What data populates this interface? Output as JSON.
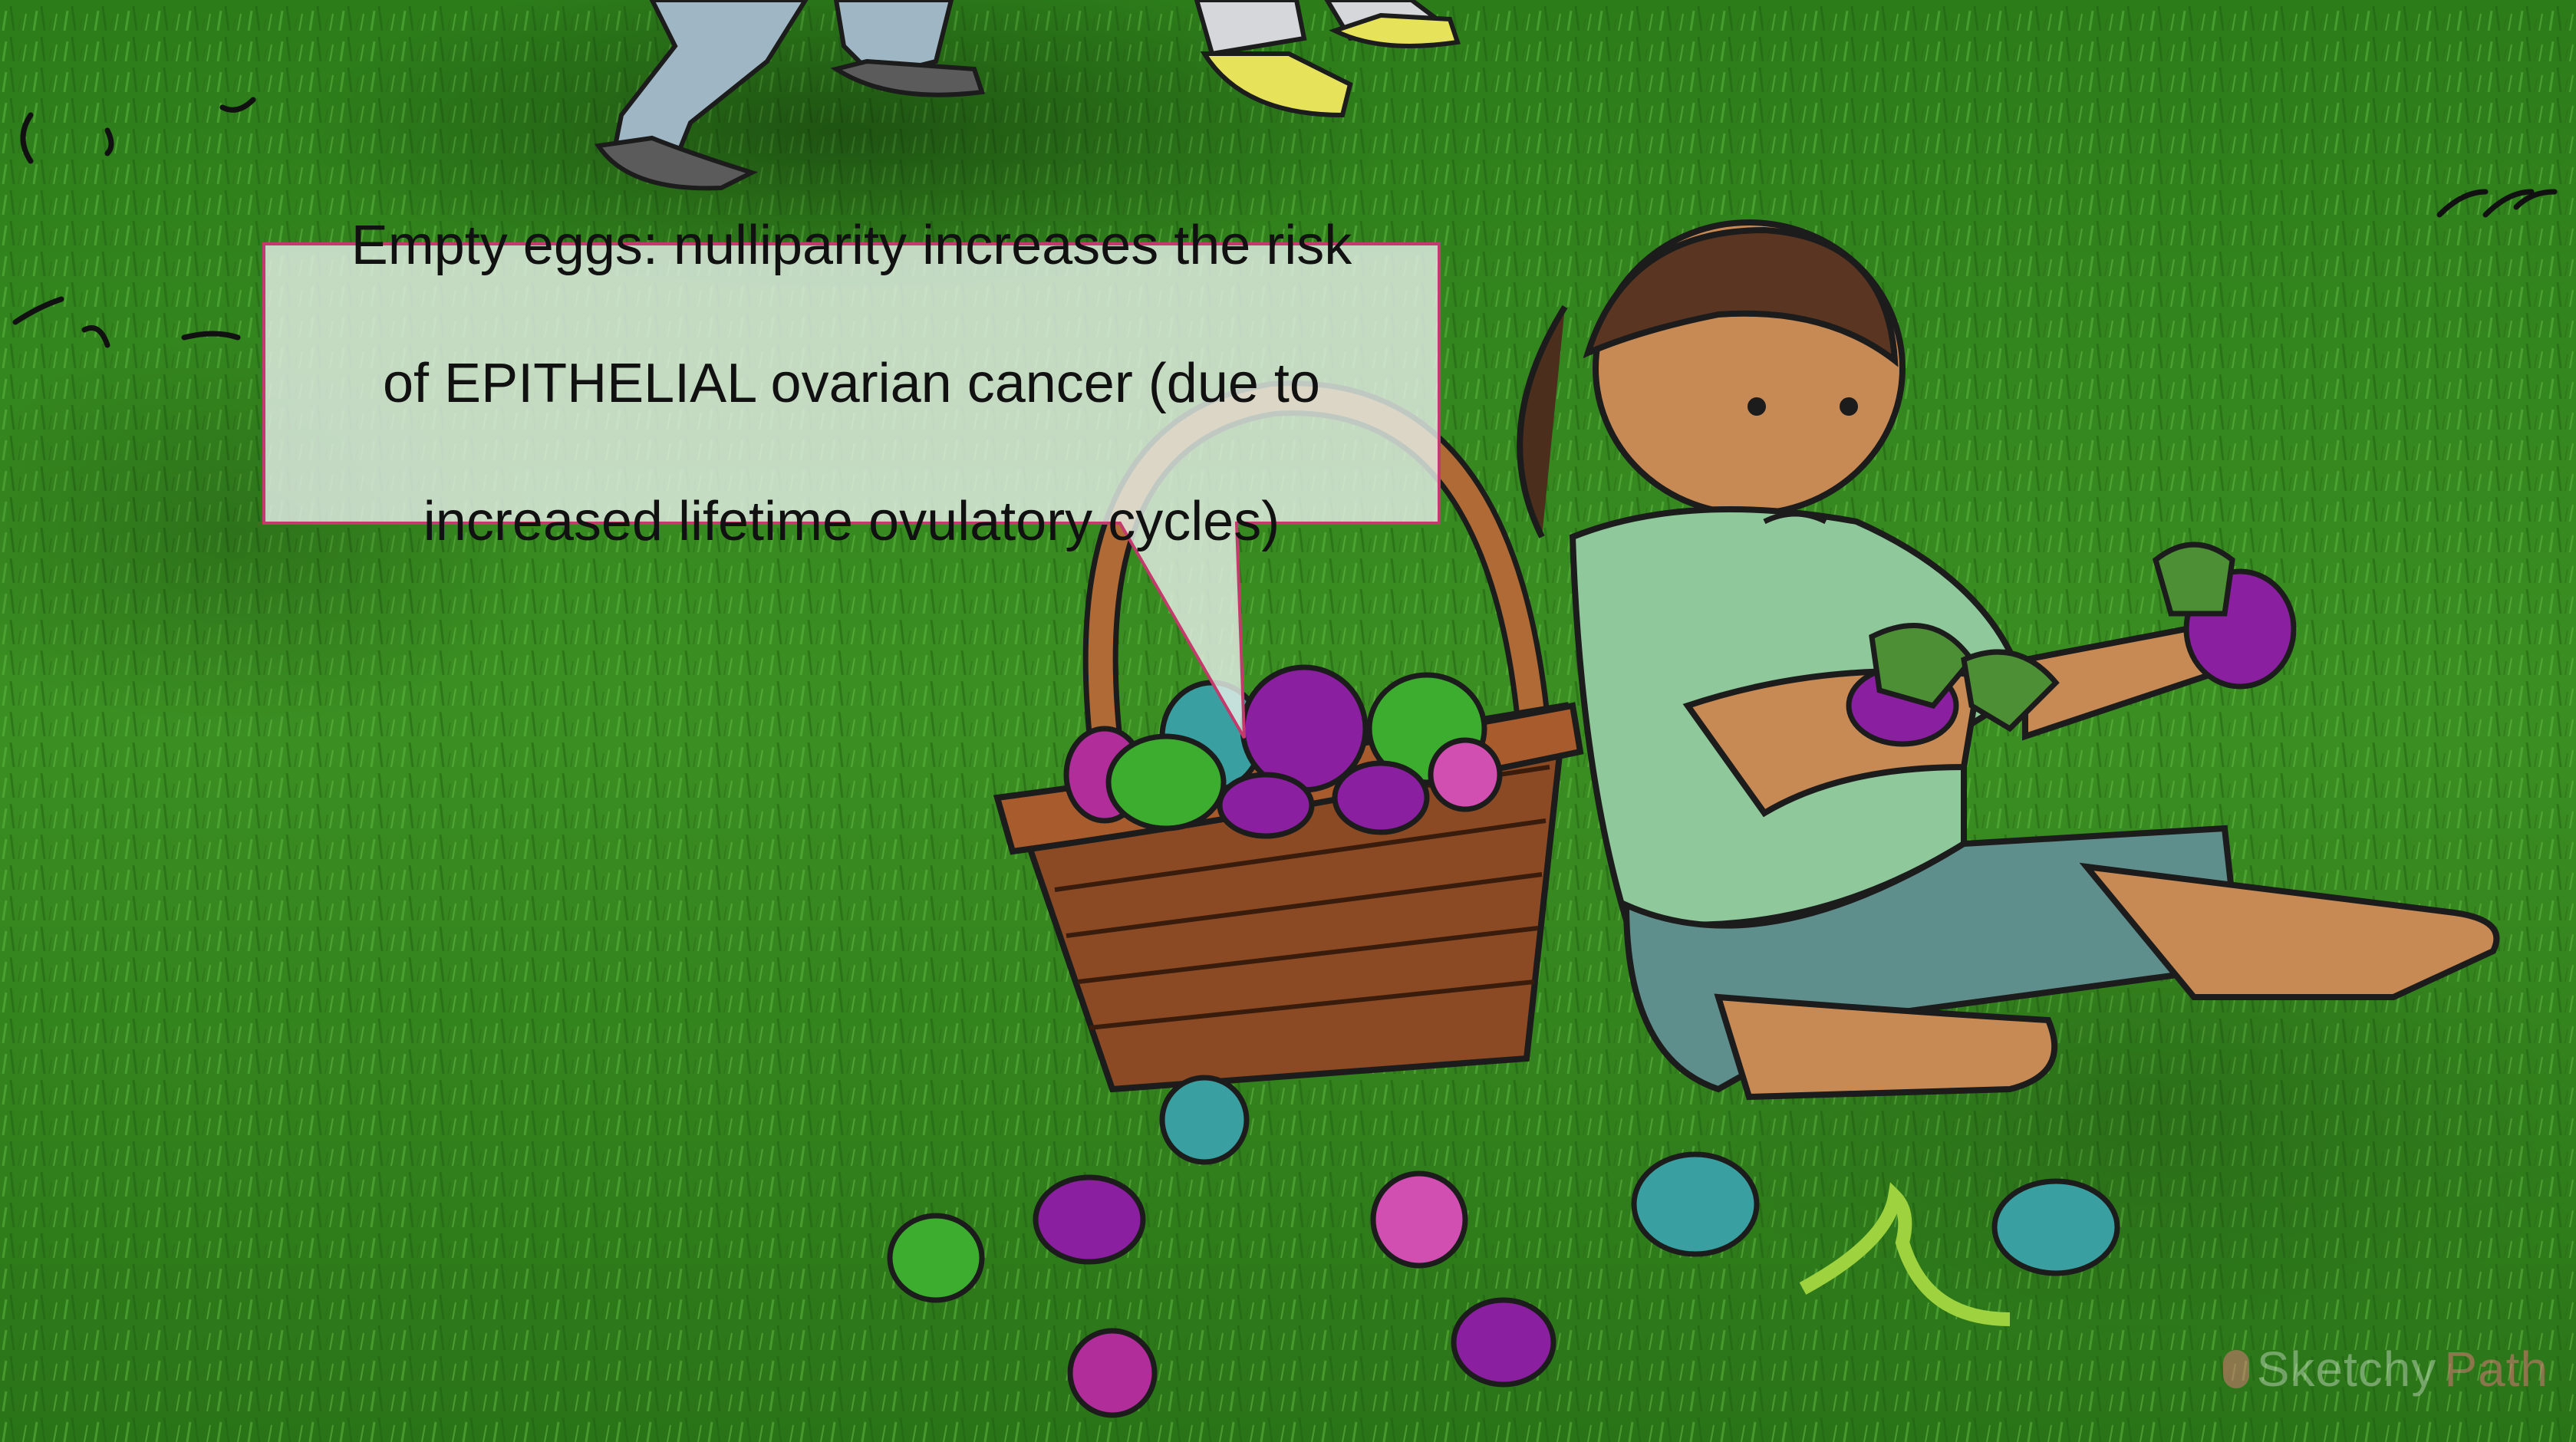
{
  "caption": {
    "line1": "Empty eggs: nulliparity increases the risk",
    "line2": "of EPITHELIAL ovarian cancer (due to",
    "line3": "increased lifetime ovulatory cycles)"
  },
  "watermark": {
    "brand_a": "Sketchy",
    "brand_b": "Path"
  },
  "colors": {
    "grass": "#2f7d1f",
    "callout_border": "#c43a6c",
    "egg_purple": "#8a1fa0",
    "egg_green": "#3dad2f",
    "egg_teal": "#3a9fa0",
    "basket": "#8b4a24"
  }
}
